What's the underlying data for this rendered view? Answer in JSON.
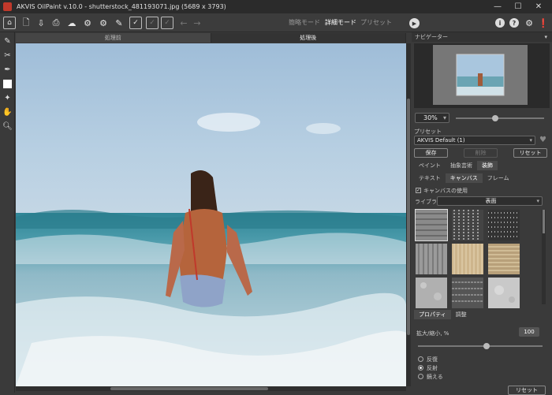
{
  "window": {
    "title": "AKVIS OilPaint v.10.0 - shutterstock_481193071.jpg (5689 x 3793)",
    "minimize": "—",
    "maximize": "☐",
    "close": "✕"
  },
  "toolbar": {
    "modes": {
      "express": "簡略モード",
      "advanced": "詳細モード",
      "presets": "プリセット"
    }
  },
  "view_tabs": {
    "before": "処理前",
    "after": "処理後"
  },
  "navigator": {
    "title": "ナビゲーター",
    "zoom": "30%",
    "zoom_slider_fraction": 0.45
  },
  "presets": {
    "label": "プリセット",
    "selected": "AKVIS Default (1)",
    "save": "保存",
    "delete": "削除",
    "reset": "リセット"
  },
  "main_tabs": [
    "ペイント",
    "抽象芸術",
    "装飾"
  ],
  "sub_tabs": [
    "テキスト",
    "キャンバス",
    "フレーム"
  ],
  "canvas_settings": {
    "use_canvas_label": "キャンバスの使用",
    "use_canvas_checked": true,
    "library_label": "ライブラリ",
    "library_value": "表面"
  },
  "bottom_tabs": [
    "プロパティ",
    "調整"
  ],
  "scale": {
    "label": "拡大/縮小, %",
    "value": "100",
    "slider_fraction": 0.55
  },
  "mode_options": {
    "items": [
      "反復",
      "反射",
      "鏡える"
    ],
    "selected": 1
  },
  "reset_bottom": "リセット",
  "colors": {
    "accent": "#c0392b",
    "sky": "#a9c6de",
    "sea": "#3f8fa0"
  }
}
